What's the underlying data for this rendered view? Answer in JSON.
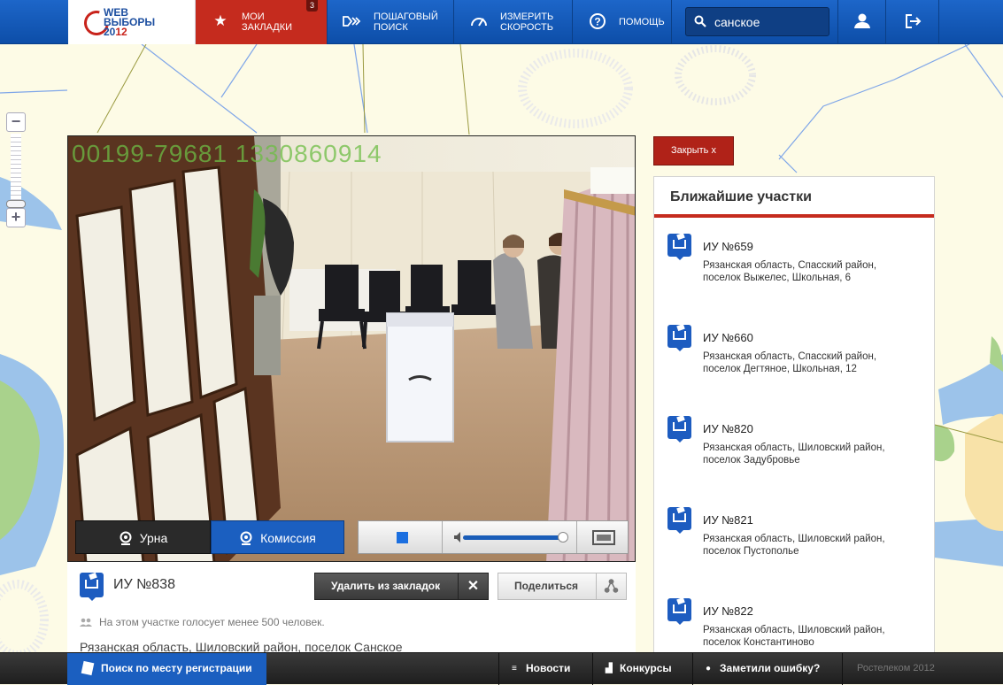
{
  "header": {
    "logo": {
      "line1": "WEB",
      "line2": "ВЫБОРЫ",
      "line3_a": "20",
      "line3_b": "12"
    },
    "nav": {
      "bookmarks": {
        "label": "МОИ ЗАКЛАДКИ",
        "count": "3"
      },
      "stepsearch": {
        "label": "ПОШАГОВЫЙ ПОИСК"
      },
      "speed": {
        "label": "ИЗМЕРИТЬ СКОРОСТЬ"
      },
      "help": {
        "label": "ПОМОЩЬ"
      }
    },
    "search": {
      "value": "санское"
    }
  },
  "video": {
    "timestamp": "00199-79681 1330860914",
    "tabs": {
      "urn": "Урна",
      "commission": "Комиссия"
    },
    "volume": 0.95,
    "active_tab": "commission"
  },
  "station": {
    "title": "ИУ №838",
    "remove_label": "Удалить из закладок",
    "share_label": "Поделиться",
    "voters_note": "На этом участке голосует менее 500 человек.",
    "address": "Рязанская область, Шиловский район, поселок Санское"
  },
  "side": {
    "close_label": "Закрыть  x",
    "heading": "Ближайшие участки",
    "stations": [
      {
        "name": "ИУ №659",
        "line1": "Рязанская область, Спасский район,",
        "line2": "поселок Выжелес, Школьная, 6"
      },
      {
        "name": "ИУ №660",
        "line1": "Рязанская область, Спасский район,",
        "line2": "поселок Дегтяное, Школьная, 12"
      },
      {
        "name": "ИУ №820",
        "line1": "Рязанская область, Шиловский район,",
        "line2": "поселок Задубровье"
      },
      {
        "name": "ИУ №821",
        "line1": "Рязанская область, Шиловский район,",
        "line2": "поселок Пустополье"
      },
      {
        "name": "ИУ №822",
        "line1": "Рязанская область, Шиловский район,",
        "line2": "поселок Константиново"
      }
    ]
  },
  "footer": {
    "register_search": "Поиск по месту регистрации",
    "news": "Новости",
    "contests": "Конкурсы",
    "report_error": "Заметили ошибку?",
    "copyright": "Ростелеком 2012"
  },
  "colors": {
    "brand_blue": "#1b5fc0",
    "brand_red": "#c52b1e",
    "map_bg": "#fdfbe6"
  }
}
